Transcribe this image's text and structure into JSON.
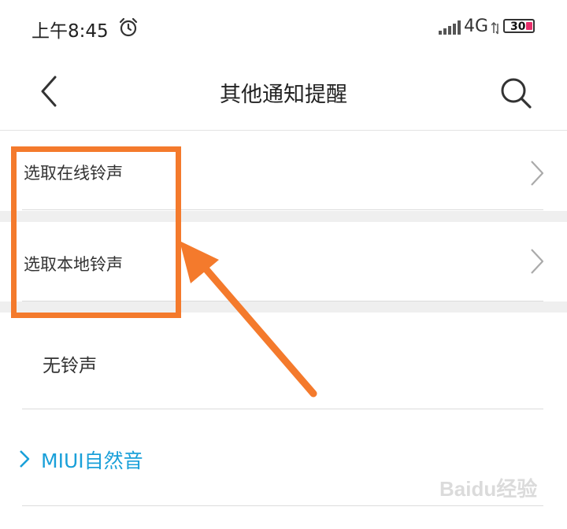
{
  "status_bar": {
    "time": "上午8:45",
    "network": "4G",
    "battery": "30",
    "icons": [
      "alarm-icon",
      "signal-icon",
      "data-arrows-icon",
      "battery-icon"
    ]
  },
  "header": {
    "title": "其他通知提醒",
    "back_icon": "back-chevron-icon",
    "search_icon": "search-icon"
  },
  "options": [
    {
      "label": "选取在线铃声",
      "has_chevron": true
    },
    {
      "label": "选取本地铃声",
      "has_chevron": true
    },
    {
      "label": "无铃声",
      "has_chevron": false
    }
  ],
  "section": {
    "label": "MIUI自然音",
    "icon": "expand-chevron-icon"
  },
  "watermark": {
    "text": "Baidu经验"
  },
  "colors": {
    "accent": "#1aa0d9",
    "highlight": "#f47a2c",
    "battery_low": "#e8306b",
    "divider": "#dcdcdc"
  }
}
